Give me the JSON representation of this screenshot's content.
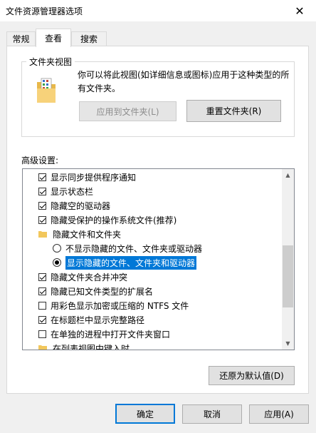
{
  "window": {
    "title": "文件资源管理器选项"
  },
  "tabs": [
    {
      "label": "常规"
    },
    {
      "label": "查看"
    },
    {
      "label": "搜索"
    }
  ],
  "folder_views": {
    "legend": "文件夹视图",
    "description": "你可以将此视图(如详细信息或图标)应用于这种类型的所有文件夹。",
    "apply_button": "应用到文件夹(L)",
    "reset_button": "重置文件夹(R)"
  },
  "advanced": {
    "label": "高级设置:",
    "items": [
      {
        "text": "显示同步提供程序通知"
      },
      {
        "text": "显示状态栏"
      },
      {
        "text": "隐藏空的驱动器"
      },
      {
        "text": "隐藏受保护的操作系统文件(推荐)"
      },
      {
        "text": "隐藏文件和文件夹"
      },
      {
        "text": "不显示隐藏的文件、文件夹或驱动器"
      },
      {
        "text": "显示隐藏的文件、文件夹和驱动器"
      },
      {
        "text": "隐藏文件夹合并冲突"
      },
      {
        "text": "隐藏已知文件类型的扩展名"
      },
      {
        "text": "用彩色显示加密或压缩的 NTFS 文件"
      },
      {
        "text": "在标题栏中显示完整路径"
      },
      {
        "text": "在单独的进程中打开文件夹窗口"
      },
      {
        "text": "在列表视图中键入时"
      }
    ],
    "restore_button": "还原为默认值(D)"
  },
  "footer": {
    "ok": "确定",
    "cancel": "取消",
    "apply": "应用(A)"
  }
}
